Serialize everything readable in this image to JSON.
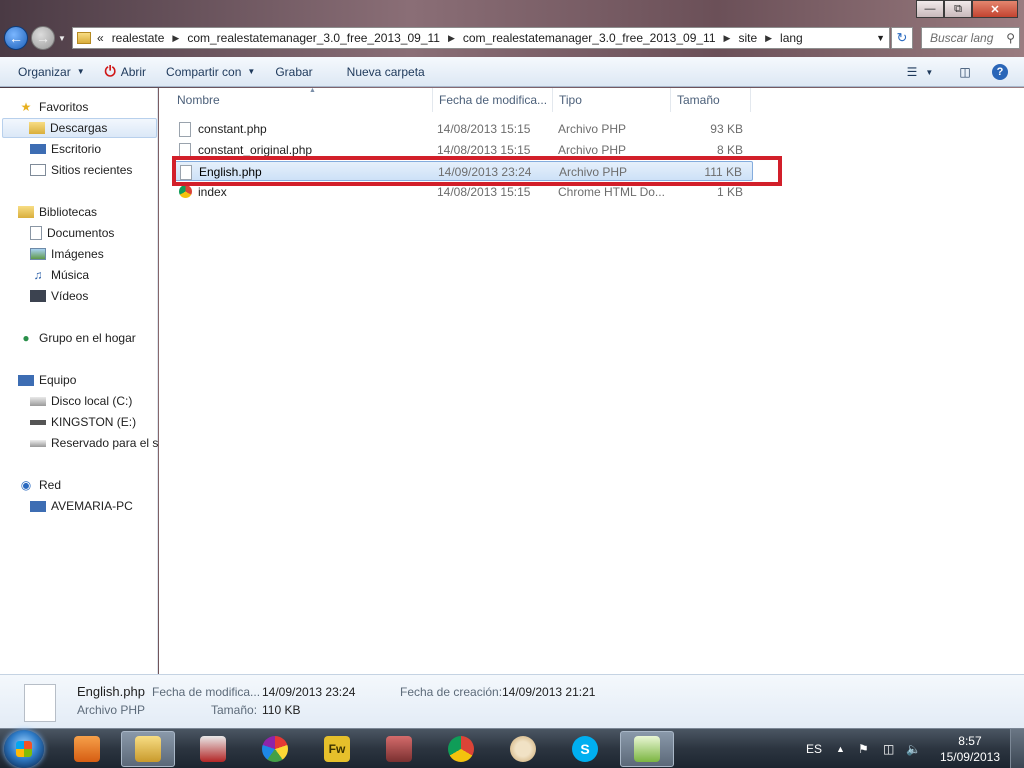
{
  "address_bar": {
    "overflow": "«",
    "crumbs": [
      "realestate",
      "com_realestatemanager_3.0_free_2013_09_11",
      "com_realestatemanager_3.0_free_2013_09_11",
      "site",
      "lang"
    ]
  },
  "search": {
    "placeholder": "Buscar lang"
  },
  "toolbar": {
    "organize": "Organizar",
    "open": "Abrir",
    "share": "Compartir con",
    "burn": "Grabar",
    "new_folder": "Nueva carpeta"
  },
  "nav": {
    "favorites": "Favoritos",
    "downloads": "Descargas",
    "desktop": "Escritorio",
    "recent": "Sitios recientes",
    "libraries": "Bibliotecas",
    "documents": "Documentos",
    "images": "Imágenes",
    "music": "Música",
    "videos": "Vídeos",
    "homegroup": "Grupo en el hogar",
    "computer": "Equipo",
    "local_disk": "Disco local (C:)",
    "kingston": "KINGSTON (E:)",
    "reserved": "Reservado para el sis",
    "network": "Red",
    "pc": "AVEMARIA-PC"
  },
  "columns": {
    "name": "Nombre",
    "date": "Fecha de modifica...",
    "type": "Tipo",
    "size": "Tamaño"
  },
  "files": [
    {
      "name": "constant.php",
      "date": "14/08/2013 15:15",
      "type": "Archivo PHP",
      "size": "93 KB"
    },
    {
      "name": "constant_original.php",
      "date": "14/08/2013 15:15",
      "type": "Archivo PHP",
      "size": "8 KB"
    },
    {
      "name": "English.php",
      "date": "14/09/2013 23:24",
      "type": "Archivo PHP",
      "size": "111 KB"
    },
    {
      "name": "index",
      "date": "14/08/2013 15:15",
      "type": "Chrome HTML Do...",
      "size": "1 KB"
    }
  ],
  "details": {
    "filename": "English.php",
    "filetype": "Archivo PHP",
    "modified_label": "Fecha de modifica...",
    "modified_value": "14/09/2013 23:24",
    "size_label": "Tamaño:",
    "size_value": "110 KB",
    "created_label": "Fecha de creación:",
    "created_value": "14/09/2013 21:21"
  },
  "tray": {
    "language": "ES",
    "time": "8:57",
    "date": "15/09/2013"
  },
  "colors": {
    "highlight_box": "#d21f2a",
    "selection": "#cde1f7"
  }
}
